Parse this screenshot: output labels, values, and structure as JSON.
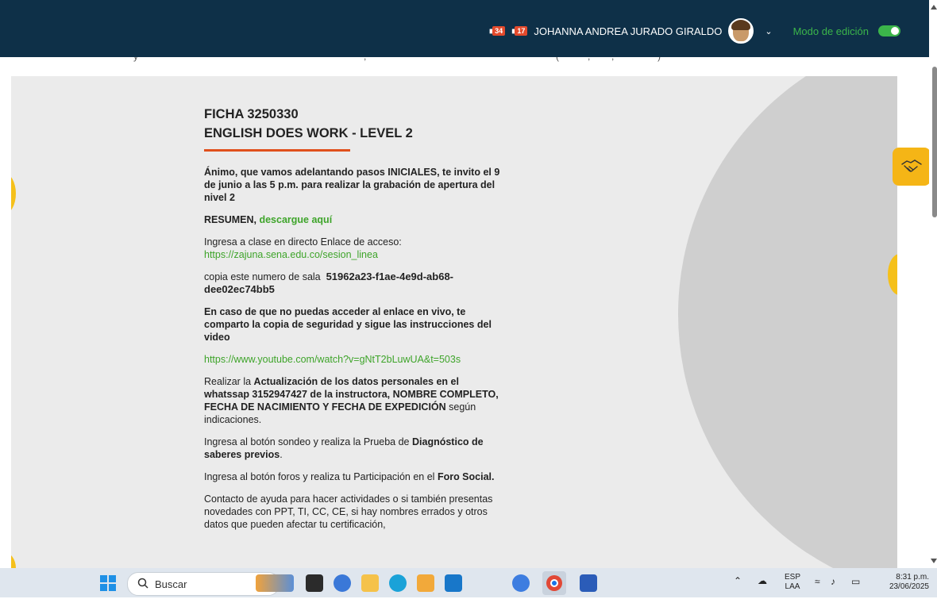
{
  "header": {
    "badge_messages": "34",
    "badge_notifications": "17",
    "user_name": "JOHANNA ANDREA JURADO GIRALDO",
    "edit_mode_label": "Modo de edición",
    "edit_mode_on": true
  },
  "course": {
    "title_line1": "FICHA 3250330",
    "title_line2": "ENGLISH DOES WORK - LEVEL 2",
    "intro": "Ánimo, que vamos adelantando pasos INICIALES, te invito el 9 de junio a las 5 p.m. para realizar la grabación de apertura del nivel 2",
    "summary_label": "RESUMEN,",
    "summary_link": "descargue aquí",
    "class_text": "Ingresa a clase en directo Enlace de acceso:",
    "class_link": "https://zajuna.sena.edu.co/sesion_linea",
    "room_text": "copia este numero de sala",
    "room_number": "51962a23-f1ae-4e9d-ab68-dee02ec74bb5",
    "backup_text": "En caso de que no puedas acceder al enlace en vivo, te comparto la copia de seguridad y sigue las instrucciones del video",
    "backup_link": "https://www.youtube.com/watch?v=gNtT2bLuwUA&t=503s",
    "update_pre": "Realizar la",
    "update_bold": "Actualización de los datos personales en el whatssap 3152947427 de la instructora, NOMBRE COMPLETO, FECHA DE NACIMIENTO Y FECHA DE EXPEDICIÓN",
    "update_post": "según indicaciones.",
    "diag_pre": "Ingresa al botón sondeo y realiza la Prueba de",
    "diag_bold": "Diagnóstico de saberes previos",
    "diag_post": ".",
    "forum_pre": "Ingresa al botón foros y realiza tu Participación en el",
    "forum_bold": "Foro Social.",
    "contact_text": "Contacto de ayuda para hacer actividades o si también presentas novedades con PPT, TI, CC, CE, si hay nombres errados y otros datos que pueden afectar tu certificación,"
  },
  "taskbar": {
    "search_placeholder": "Buscar",
    "lang_top": "ESP",
    "lang_bottom": "LAA",
    "time": "8:31 p.m.",
    "date": "23/06/2025"
  },
  "colors": {
    "header_bg": "#0e3048",
    "accent_orange": "#e0501c",
    "link_green": "#3ea42a",
    "help_yellow": "#f5b516"
  }
}
